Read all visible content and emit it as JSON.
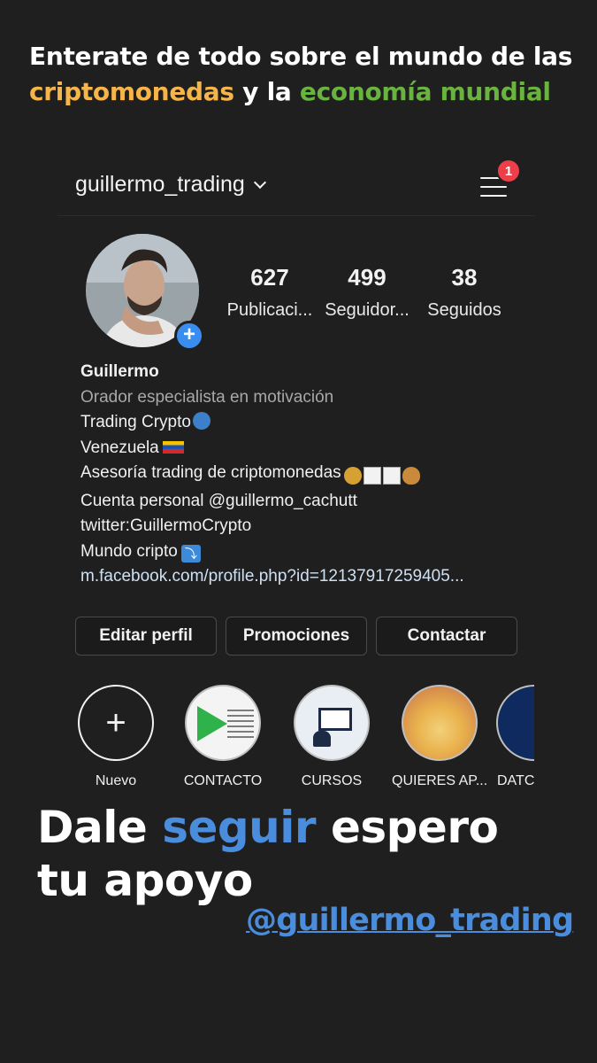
{
  "headline": {
    "part1": "Enterate de todo sobre el mundo de las ",
    "highlight1": "criptomonedas",
    "part2": " y la ",
    "highlight2": "economía mundial",
    "colors": {
      "white": "#ffffff",
      "orange": "#f6b54b",
      "green": "#69b43f"
    }
  },
  "header": {
    "username": "guillermo_trading",
    "notification_count": "1"
  },
  "profile": {
    "stats": [
      {
        "value": "627",
        "label": "Publicaci..."
      },
      {
        "value": "499",
        "label": "Seguidor..."
      },
      {
        "value": "38",
        "label": "Seguidos"
      }
    ],
    "name": "Guillermo",
    "category": "Orador especialista en motivación",
    "bio_lines": [
      "Trading Crypto",
      "Venezuela",
      "Asesoría trading de criptomonedas",
      "Cuenta personal @guillermo_cachutt",
      "twitter:GuillermoCrypto",
      "Mundo cripto"
    ],
    "link": "m.facebook.com/profile.php?id=12137917259405..."
  },
  "buttons": {
    "edit": "Editar perfil",
    "promotions": "Promociones",
    "contact": "Contactar"
  },
  "highlights": [
    {
      "label": "Nuevo",
      "icon": "plus-icon"
    },
    {
      "label": "CONTACTO",
      "icon": "contact-card-icon"
    },
    {
      "label": "CURSOS",
      "icon": "presentation-board-icon"
    },
    {
      "label": "QUIERES AP...",
      "icon": "money-hands-icon"
    },
    {
      "label": "DATC",
      "icon": "cripto-badge-icon"
    }
  ],
  "cta": {
    "part1": "Dale ",
    "highlight": "seguir",
    "part2": " espero tu apoyo",
    "mention": "@guillermo_trading",
    "accent": "#4a8ddd"
  }
}
